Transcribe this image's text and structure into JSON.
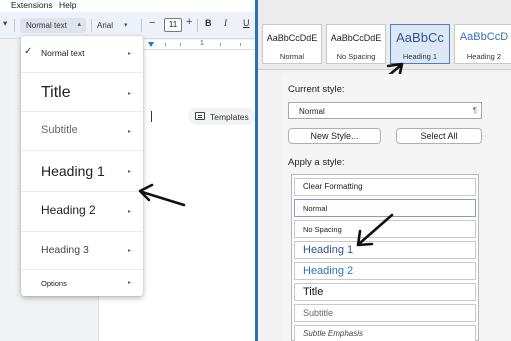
{
  "left_pane": {
    "menubar": {
      "extensions": "Extensions",
      "help": "Help"
    },
    "toolbar": {
      "style_value": "Normal text",
      "font_value": "Arial",
      "font_size": "11",
      "size_minus": "−",
      "size_plus": "+",
      "bold": "B",
      "italic": "I",
      "underline": "U"
    },
    "ruler_number": "1",
    "templates_label": "Templates",
    "style_menu": {
      "items": [
        {
          "label": "Normal text",
          "checked": true
        },
        {
          "label": "Title"
        },
        {
          "label": "Subtitle"
        },
        {
          "label": "Heading 1"
        },
        {
          "label": "Heading 2"
        },
        {
          "label": "Heading 3"
        },
        {
          "label": "Options"
        }
      ],
      "check_glyph": "✓",
      "submenu_glyph": "▸"
    }
  },
  "right_pane": {
    "gallery": [
      {
        "sample": "AaBbCcDdE",
        "name": "Normal"
      },
      {
        "sample": "AaBbCcDdE",
        "name": "No Spacing"
      },
      {
        "sample": "AaBbCc",
        "name": "Heading 1",
        "selected": true
      },
      {
        "sample": "AaBbCcD",
        "name": "Heading 2"
      }
    ],
    "current_style_label": "Current style:",
    "current_style_value": "Normal",
    "pilcrow": "¶",
    "new_style_button": "New Style...",
    "select_all_button": "Select All",
    "apply_label": "Apply a style:",
    "apply_styles": [
      "Clear Formatting",
      "Normal",
      "No Spacing",
      "Heading 1",
      "Heading 2",
      "Title",
      "Subtitle",
      "Subtle Emphasis"
    ]
  },
  "colors": {
    "heading_blue": "#2f5496",
    "heading2_blue": "#2e74b5",
    "splitter": "#2b6fb7",
    "accent": "#1a73e8"
  }
}
